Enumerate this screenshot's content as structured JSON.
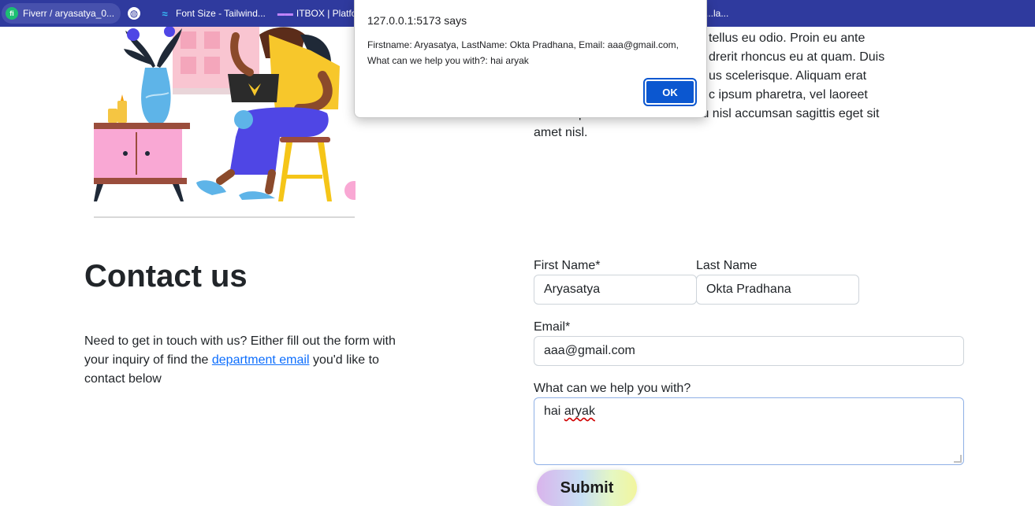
{
  "bookmarks": [
    {
      "label": "Fiverr / aryasatya_0...",
      "icon": "fiverr-icon"
    },
    {
      "label": "",
      "icon": "globe-icon"
    },
    {
      "label": "Font Size - Tailwind...",
      "icon": "tailwind-icon"
    },
    {
      "label": "ITBOX | Platform",
      "icon": "itbox-icon"
    }
  ],
  "bookmarks_overflow": "...la...",
  "paragraph": {
    "lines": [
      "tellus eu odio. Proin eu ante",
      "drerit rhoncus eu at quam. Duis",
      "us scelerisque. Aliquam erat",
      "c ipsum pharetra, vel laoreet",
      "eros aliquet. Duis sed lectus eu nisl accumsan sagittis eget sit",
      "amet nisl."
    ]
  },
  "contact": {
    "title": "Contact us",
    "desc_before": "Need to get in touch with us? Either fill out the form with your inquiry of find the ",
    "desc_link": "department email",
    "desc_after": " you'd like to contact below"
  },
  "form": {
    "first_name_label": "First Name*",
    "first_name_value": "Aryasatya",
    "last_name_label": "Last Name",
    "last_name_value": "Okta Pradhana",
    "email_label": "Email*",
    "email_value": "aaa@gmail.com",
    "help_label": "What can we help you with?",
    "help_value_word1": "hai",
    "help_value_word2": "aryak",
    "submit_label": "Submit"
  },
  "dialog": {
    "title": "127.0.0.1:5173 says",
    "message": "Firstname: Aryasatya, LastName: Okta Pradhana, Email: aaa@gmail.com, What can we help you with?: hai aryak",
    "ok_label": "OK"
  },
  "colors": {
    "bookmark_bar": "#2f3a9e",
    "link": "#0d6efd",
    "dialog_button": "#0b57d0"
  }
}
